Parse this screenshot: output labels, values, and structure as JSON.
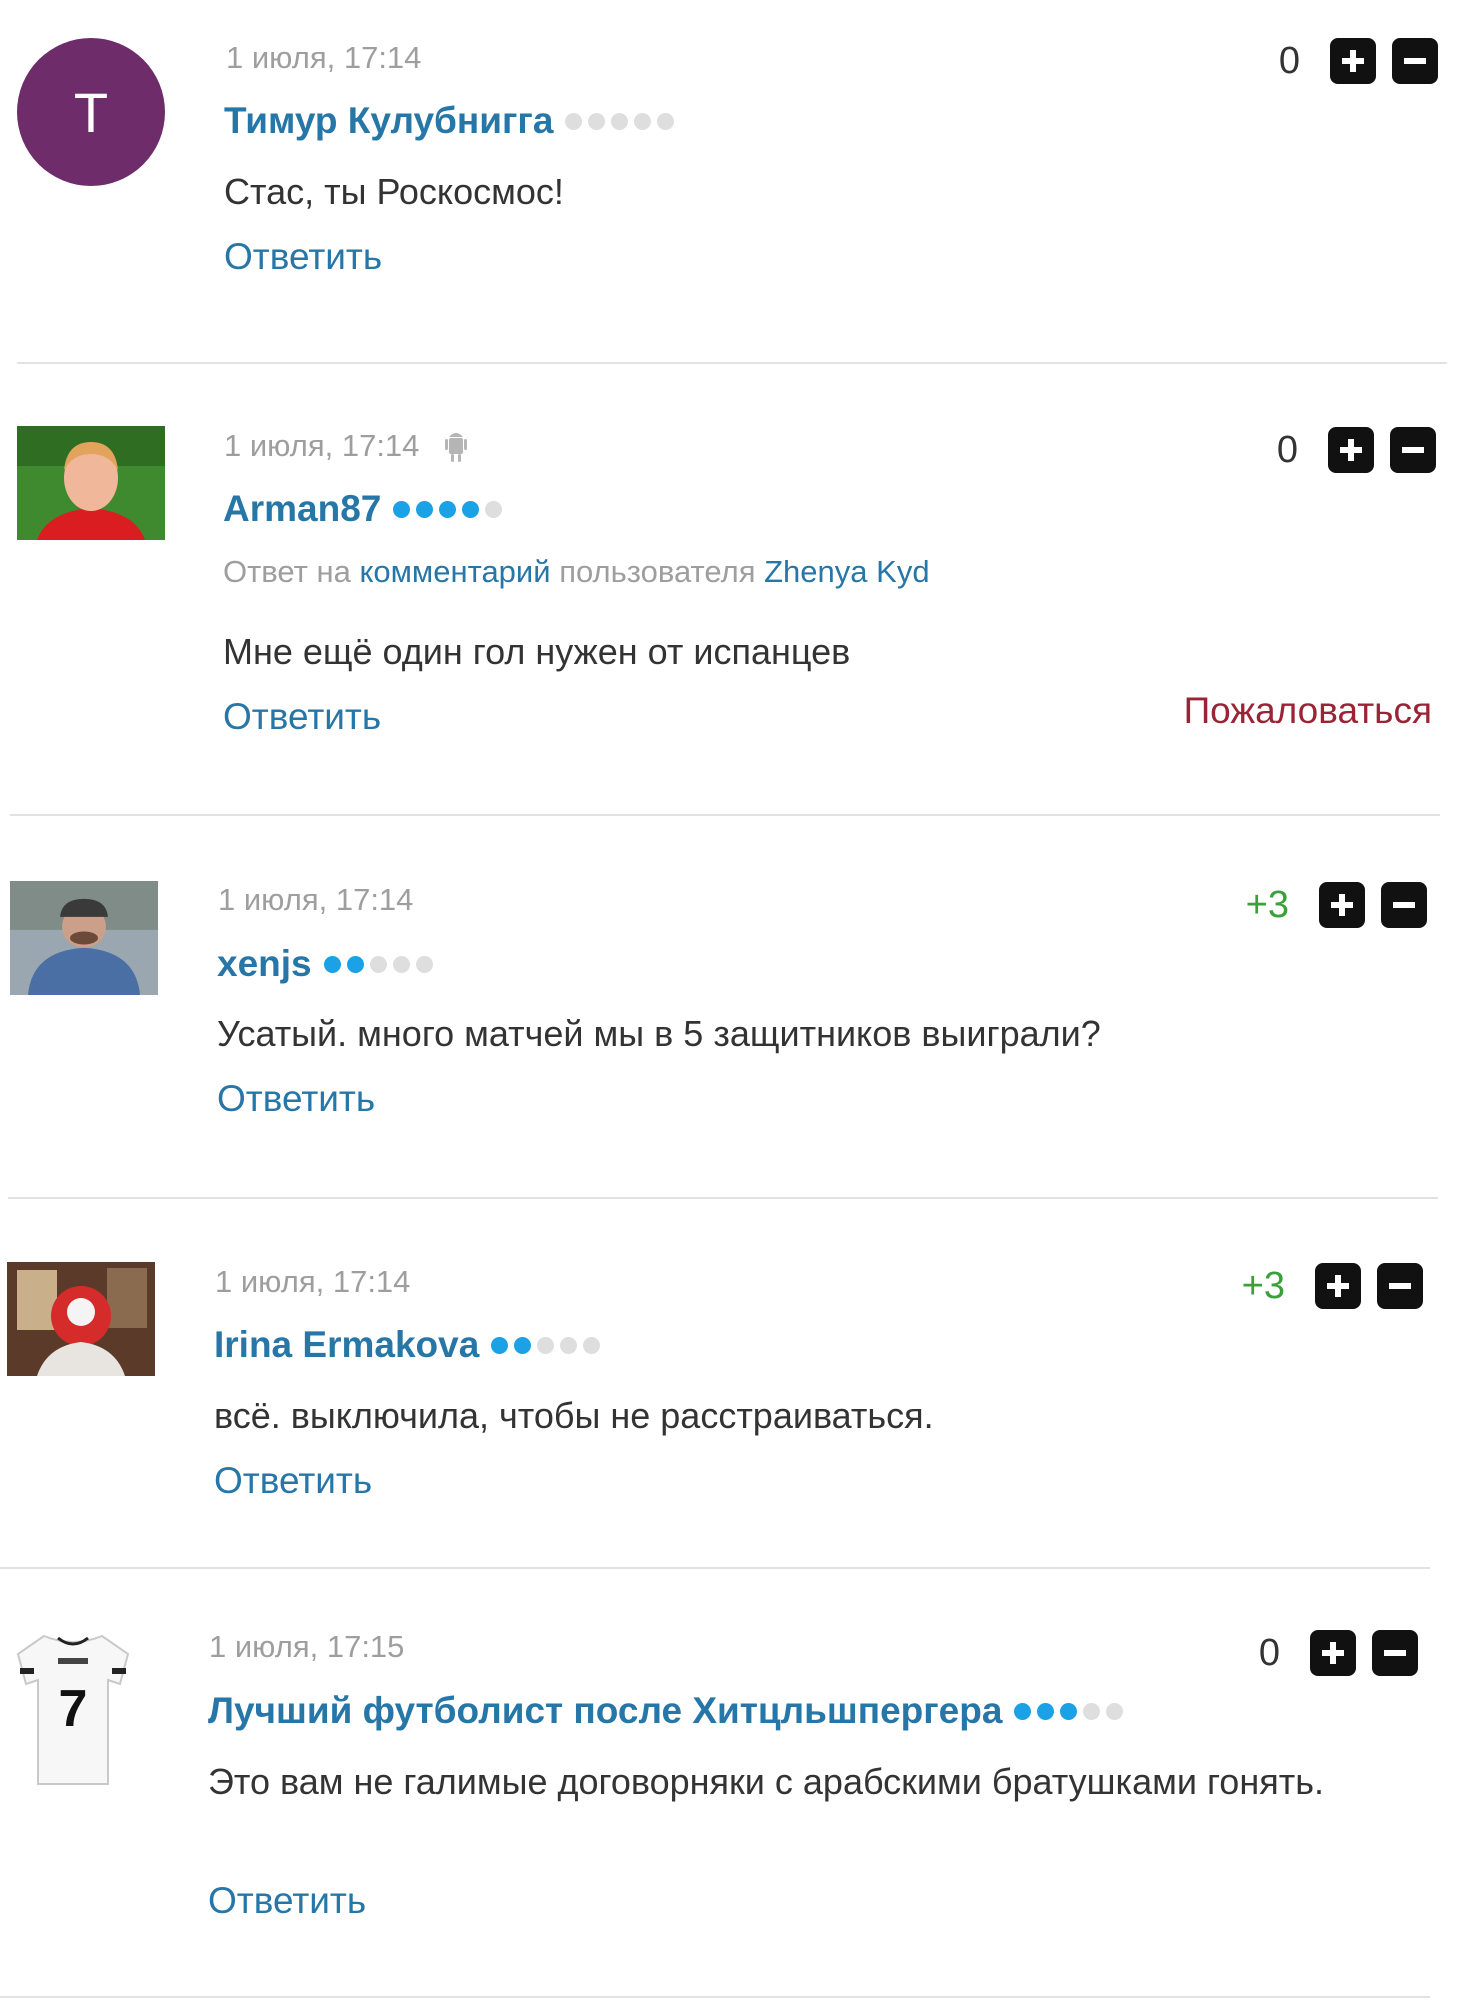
{
  "colors": {
    "link": "#2776a8",
    "meta": "#9e9e9e",
    "positive": "#3aa13a",
    "complain": "#9b2336",
    "rating_on": "#1aa1e6",
    "rating_off": "#dedede"
  },
  "labels": {
    "reply": "Ответить",
    "complain": "Пожаловаться",
    "reply_to_prefix": "Ответ на",
    "reply_to_link": "комментарий",
    "reply_to_middle": "пользователя"
  },
  "comments": [
    {
      "date": "1 июля, 17:14",
      "author": "Тимур Кулубнигга",
      "avatar_letter": "Т",
      "rating_level": 0,
      "text": "Стас, ты Роскосмос!",
      "score": "0"
    },
    {
      "date": "1 июля, 17:14",
      "device_icon": "android-icon",
      "author": "Arman87",
      "rating_level": 4,
      "reply_to_user": "Zhenya Kyd",
      "text": "Мне ещё один гол нужен от испанцев",
      "score": "0"
    },
    {
      "date": "1 июля, 17:14",
      "author": "xenjs",
      "rating_level": 2,
      "text": "Усатый. много матчей мы в 5 защитников выиграли?",
      "score": "+3"
    },
    {
      "date": "1 июля, 17:14",
      "author": "Irina Ermakova",
      "rating_level": 2,
      "text": "всё. выключила, чтобы не расстраиваться.",
      "score": "+3"
    },
    {
      "date": "1 июля, 17:15",
      "author": "Лучший футболист после Хитцльшпергера",
      "rating_level": 3,
      "text": "Это вам не галимые договорняки с арабскими братушками гонять.",
      "score": "0",
      "avatar_shirt_text": "7"
    }
  ]
}
